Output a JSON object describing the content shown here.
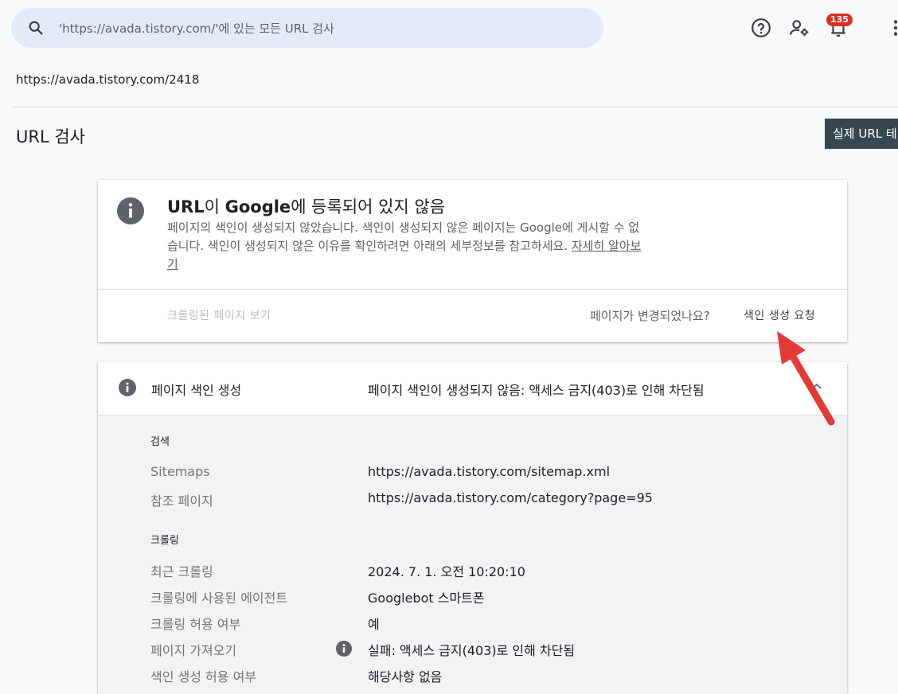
{
  "search": {
    "placeholder": "'https://avada.tistory.com/'에 있는 모든 URL 검사",
    "icon": "search-icon"
  },
  "toolbar": {
    "help_icon": "help-icon",
    "manage_users_icon": "manage-users-icon",
    "notifications_icon": "notifications-icon",
    "notification_count": "135",
    "more_icon": "more-vert-icon"
  },
  "inspected_url": "https://avada.tistory.com/2418",
  "page": {
    "title": "URL 검사",
    "live_test_button": "실제 URL 테"
  },
  "status_card": {
    "title_prefix": "URL",
    "title_mid": "이 ",
    "title_brand": "Google",
    "title_suffix": "에 등록되어 있지 않음",
    "description": "페이지의 색인이 생성되지 않았습니다. 색인이 생성되지 않은 페이지는 Google에 게시할 수 없습니다. 색인이 생성되지 않은 이유를 확인하려면 아래의 세부정보를 참고하세요.",
    "learn_more": "자세히 알아보기",
    "view_crawled": "크롤링된 페이지 보기",
    "changed_question": "페이지가 변경되었나요?",
    "request_indexing": "색인 생성 요청"
  },
  "indexing": {
    "label": "페이지 색인 생성",
    "status": "페이지 색인이 생성되지 않음: 액세스 금지(403)로 인해 차단됨",
    "discovery": {
      "title": "검색",
      "rows": [
        {
          "label": "Sitemaps",
          "value": "https://avada.tistory.com/sitemap.xml"
        },
        {
          "label": "참조 페이지",
          "value": "https://avada.tistory.com/category?page=95"
        }
      ]
    },
    "crawl": {
      "title": "크롤링",
      "rows": [
        {
          "label": "최근 크롤링",
          "value": "2024. 7. 1. 오전 10:20:10"
        },
        {
          "label": "크롤링에 사용된 에이전트",
          "value": "Googlebot 스마트폰"
        },
        {
          "label": "크롤링 허용 여부",
          "value": "예"
        },
        {
          "label": "페이지 가져오기",
          "value": "실패: 액세스 금지(403)로 인해 차단됨"
        },
        {
          "label": "색인 생성 허용 여부",
          "value": "해당사항 없음"
        }
      ]
    }
  },
  "colors": {
    "search_bg": "#e3ebfb",
    "badge": "#d93025",
    "live_button": "#37474f",
    "arrow": "#e53935"
  }
}
